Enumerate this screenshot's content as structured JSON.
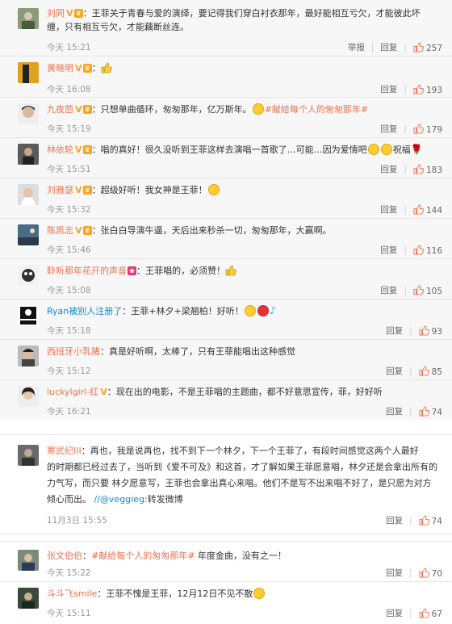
{
  "comments_a": [
    {
      "user": "刘同",
      "text": "：王菲关于青春与爱的演绎，要记得我们穿白衬衣那年，最好能相互亏欠，才能彼此坏",
      "text2": "缠，只有相互亏欠，才能藕断丝连。",
      "time": "今天 15:21",
      "report": "举报",
      "reply": "回复",
      "likes": "257"
    },
    {
      "user": "黄晓明",
      "text": "：",
      "time": "今天 16:08",
      "reply": "回复",
      "likes": "193"
    },
    {
      "user": "九夜茴",
      "text": "：只想单曲循环，匆匆那年，亿万斯年。",
      "tag": "#献给每个人的匆匆那年#",
      "time": "今天 15:19",
      "reply": "回复",
      "likes": "179"
    },
    {
      "user": "林依轮",
      "text": "：唱的真好！很久没听到王菲这样去演唱一首歌了…可能…因为爱情吧",
      "text_end": "祝福",
      "time": "今天 15:51",
      "reply": "回复",
      "likes": "183"
    },
    {
      "user": "刘雅瑟",
      "text": "：超级好听！我女神是王菲！",
      "time": "今天 15:32",
      "reply": "回复",
      "likes": "144"
    },
    {
      "user": "陈凯志",
      "text": "：张白白导演牛逼，天后出来秒杀一切，匆匆那年，大赢啊。",
      "time": "今天 15:46",
      "reply": "回复",
      "likes": "116"
    },
    {
      "user": "聆听那年花开的声音",
      "text": "：王菲唱的，必须赞！",
      "time": "今天 15:08",
      "reply": "回复",
      "likes": "105"
    },
    {
      "user": "Ryan被别人注册了",
      "text": "：王菲+林夕+梁翘柏！好听！",
      "time": "今天 15:18",
      "reply": "回复",
      "likes": "93"
    },
    {
      "user": "西班牙小乳猪",
      "text": "：真是好听啊，太棒了，只有王菲能唱出这种感觉",
      "time": "今天 15:12",
      "reply": "回复",
      "likes": "85"
    },
    {
      "user": "luckylgirl-红",
      "text": "：现在出的电影，不是王菲唱的主题曲，都不好意思宣传，菲，好好听",
      "time": "今天 16:21",
      "reply": "回复",
      "likes": "74"
    }
  ],
  "comment_b": {
    "user": "寒武纪III",
    "lines": [
      "：再也，我是说再也，找不到下一个林夕，下一个王菲了，有段时间感觉这两个人最好",
      "的时期都已经过去了，当听到《爱不可及》和这首，才了解如果王菲愿意唱，林夕还是会拿出所有的",
      "力气写，而只要 林夕愿意写，王菲也会拿出真心来唱。他们不是写不出来唱不好了，是只愿为对方",
      "倾心而出。"
    ],
    "mention": "//@veggieg:",
    "forward": "转发微博",
    "time": "11月3日 15:55",
    "reply": "回复",
    "likes": "74"
  },
  "comments_c": [
    {
      "user": "张文伯伯",
      "tag": "#献给每个人的匆匆那年#",
      "text": " 年度金曲，没有之一！",
      "time": "今天 15:22",
      "reply": "回复",
      "likes": "70"
    },
    {
      "user": "斗斗飞smile",
      "text": "：王菲不愧是王菲，12月12日不见不散",
      "time": "今天 15:11",
      "reply": "回复",
      "likes": "67"
    }
  ]
}
